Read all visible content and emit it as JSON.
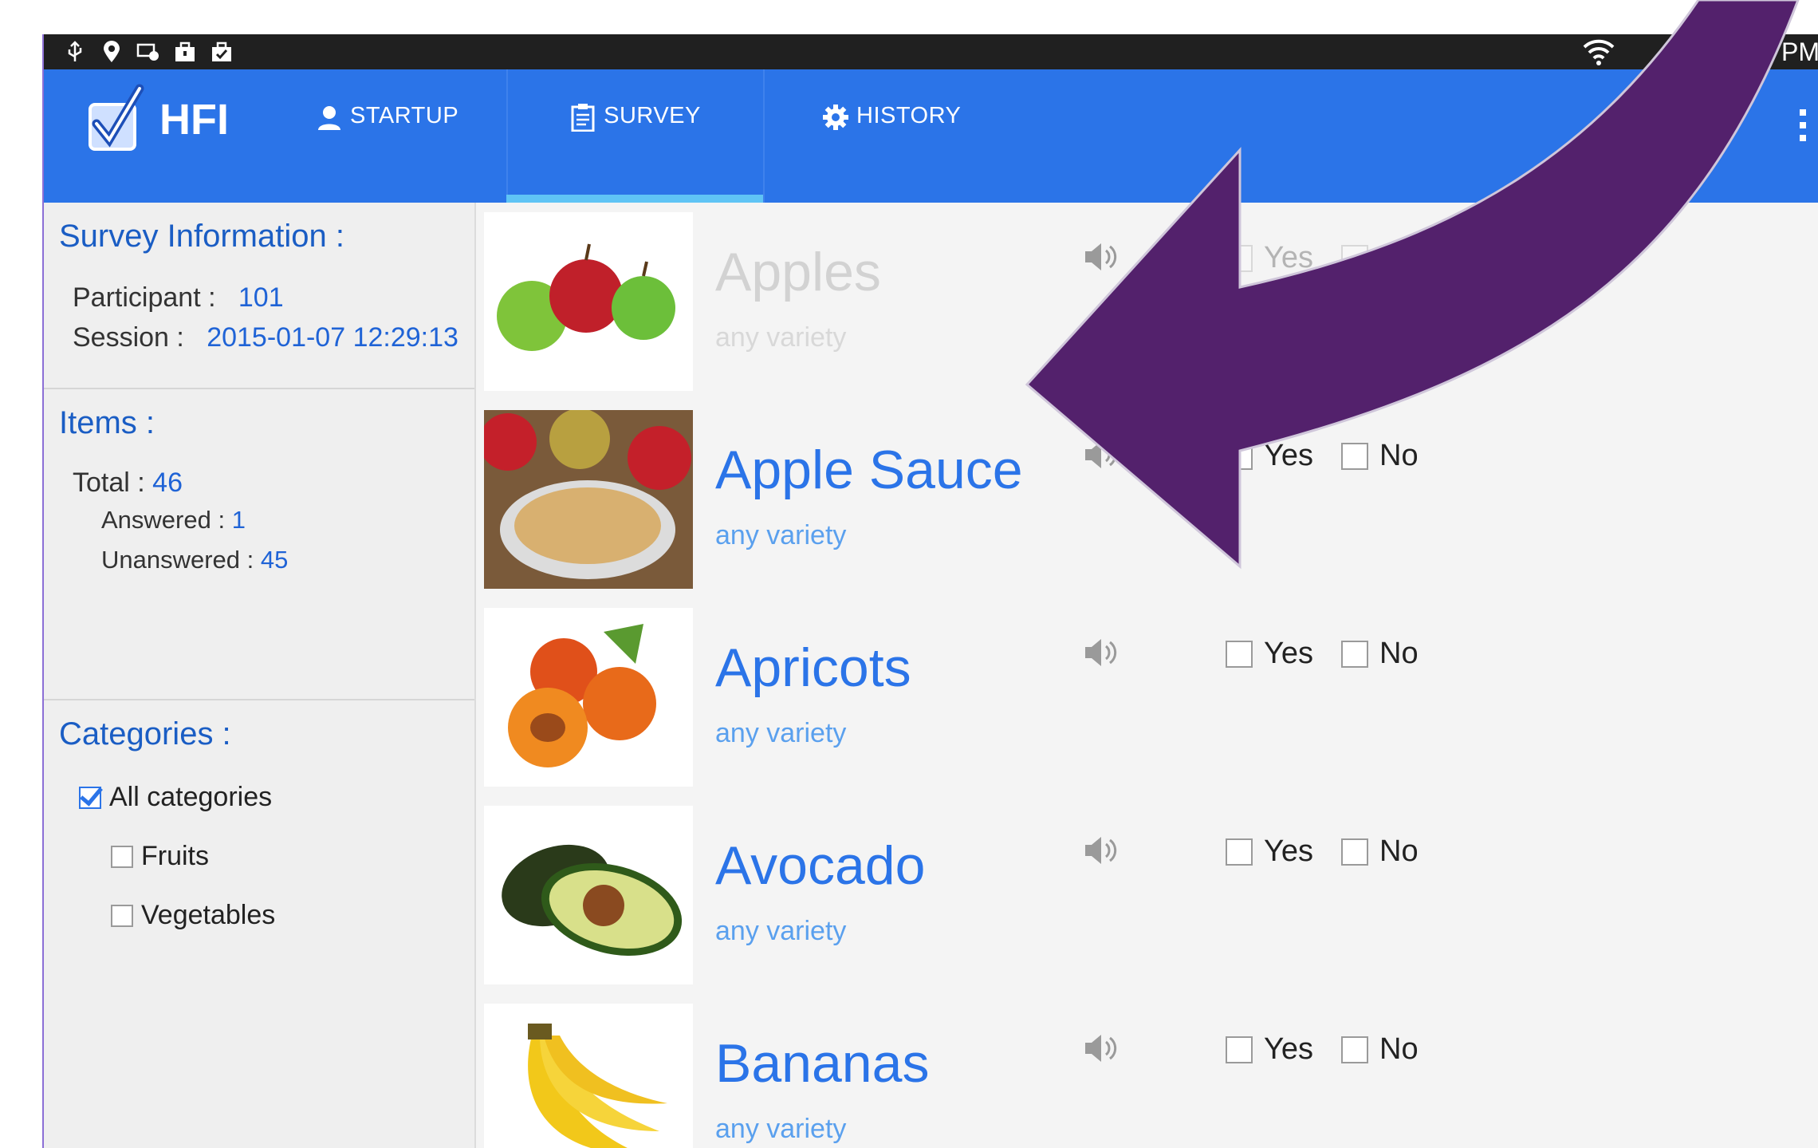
{
  "status_bar": {
    "time_fragment": "PM"
  },
  "app": {
    "title": "HFI"
  },
  "tabs": [
    {
      "label": "STARTUP"
    },
    {
      "label": "SURVEY"
    },
    {
      "label": "HISTORY"
    }
  ],
  "sidebar": {
    "survey_info": {
      "title": "Survey Information :",
      "participant_label": "Participant :",
      "participant_value": "101",
      "session_label": "Session :",
      "session_value": "2015-01-07 12:29:13"
    },
    "items": {
      "title": "Items :",
      "total_label": "Total :",
      "total_value": "46",
      "answered_label": "Answered :",
      "answered_value": "1",
      "unanswered_label": "Unanswered :",
      "unanswered_value": "45"
    },
    "categories": {
      "title": "Categories :",
      "options": [
        {
          "label": "All categories",
          "checked": true
        },
        {
          "label": "Fruits",
          "checked": false
        },
        {
          "label": "Vegetables",
          "checked": false
        }
      ]
    }
  },
  "list": {
    "yes_label": "Yes",
    "no_label": "No",
    "items": [
      {
        "name": "Apples",
        "variety": "any variety",
        "answered": true
      },
      {
        "name": "Apple Sauce",
        "variety": "any variety",
        "answered": false
      },
      {
        "name": "Apricots",
        "variety": "any variety",
        "answered": false
      },
      {
        "name": "Avocado",
        "variety": "any variety",
        "answered": false
      },
      {
        "name": "Bananas",
        "variety": "any variety",
        "answered": false
      }
    ]
  },
  "colors": {
    "action_bar": "#2b74e8",
    "accent_underline": "#5fc4f5",
    "overlay_arrow": "#53216c"
  }
}
